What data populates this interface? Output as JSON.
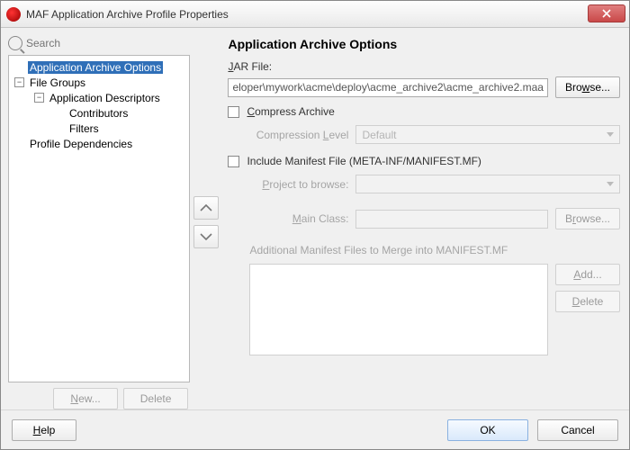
{
  "window": {
    "title": "MAF Application Archive Profile Properties"
  },
  "search": {
    "placeholder": "Search"
  },
  "tree": {
    "item0": "Application Archive Options",
    "item1": "File Groups",
    "item2": "Application Descriptors",
    "item3": "Contributors",
    "item4": "Filters",
    "item5": "Profile Dependencies"
  },
  "left_buttons": {
    "new": "New...",
    "delete": "Delete"
  },
  "panel": {
    "heading": "Application Archive Options",
    "jar_label": "JAR File:",
    "jar_value": "eloper\\mywork\\acme\\deploy\\acme_archive2\\acme_archive2.maa",
    "browse": "Browse...",
    "compress": "Compress Archive",
    "compress_level_label": "Compression Level",
    "compress_level_value": "Default",
    "include_manifest": "Include Manifest File (META-INF/MANIFEST.MF)",
    "project_label": "Project to browse:",
    "mainclass_label": "Main Class:",
    "browse2": "Browse...",
    "addl_label": "Additional Manifest Files to Merge into MANIFEST.MF",
    "add": "Add...",
    "delete": "Delete"
  },
  "footer": {
    "help": "Help",
    "ok": "OK",
    "cancel": "Cancel"
  }
}
